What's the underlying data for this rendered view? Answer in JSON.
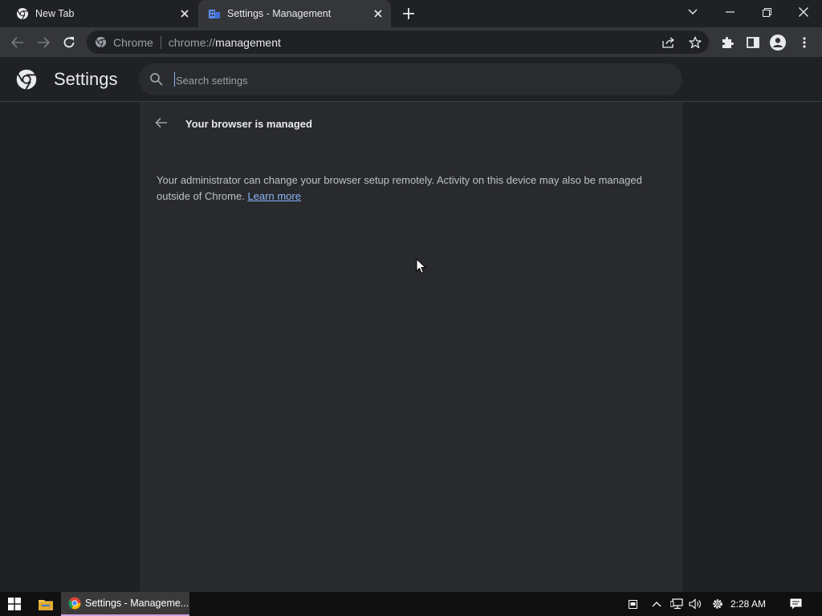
{
  "browser": {
    "tabs": [
      {
        "title": "New Tab",
        "active": false
      },
      {
        "title": "Settings - Management",
        "active": true
      }
    ],
    "omnibox": {
      "site_label": "Chrome",
      "url_prefix": "chrome://",
      "url_path": "management"
    }
  },
  "settings": {
    "title": "Settings",
    "search_placeholder": "Search settings"
  },
  "management": {
    "heading": "Your browser is managed",
    "description": "Your administrator can change your browser setup remotely. Activity on this device may also be managed outside of Chrome.",
    "learn_more": "Learn more"
  },
  "taskbar": {
    "app_label": "Settings - Manageme...",
    "clock": "2:28 AM"
  },
  "colors": {
    "background": "#202124",
    "surface": "#292a2d",
    "toolbar": "#35363a",
    "link": "#8ab4f8",
    "text": "#e8eaed"
  }
}
